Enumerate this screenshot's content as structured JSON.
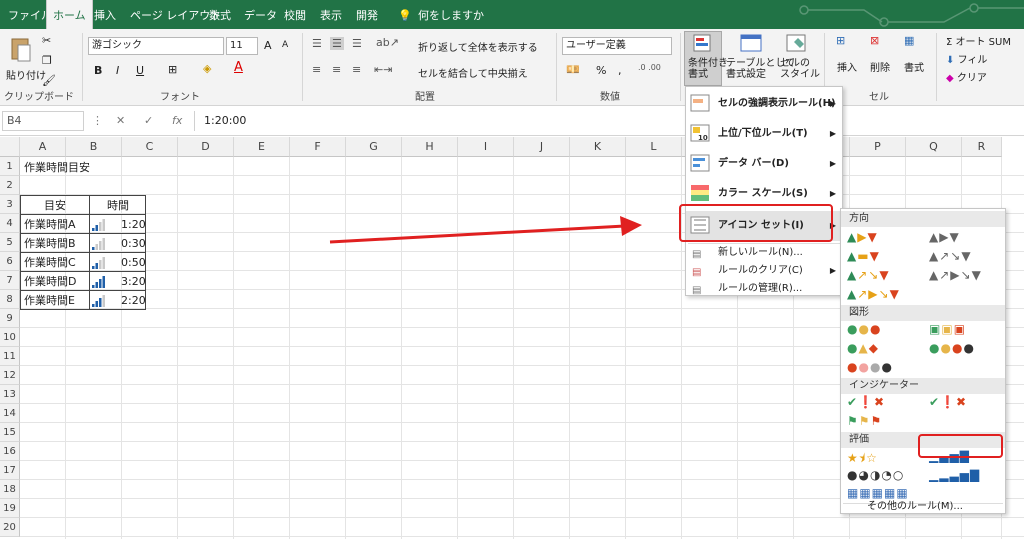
{
  "ribbon_tabs": [
    "ファイル",
    "ホーム",
    "挿入",
    "ページ レイアウト",
    "数式",
    "データ",
    "校閲",
    "表示",
    "開発",
    "何をしますか"
  ],
  "ribbon": {
    "clipboard": {
      "paste": "貼り付け",
      "label": "クリップボード"
    },
    "font": {
      "name": "游ゴシック",
      "size": "11",
      "label": "フォント",
      "grow": "A",
      "shrink": "A",
      "bold": "B",
      "italic": "I",
      "underline": "U"
    },
    "alignment": {
      "wrap": "折り返して全体を表示する",
      "merge": "セルを結合して中央揃え",
      "label": "配置"
    },
    "number": {
      "format": "ユーザー定義",
      "label": "数値",
      "percent": "%",
      "comma": ","
    },
    "styles": {
      "cond": "条件付き\n書式",
      "table": "テーブルとして\n書式設定",
      "cell": "セルの\nスタイル"
    },
    "cells": {
      "insert": "挿入",
      "delete": "削除",
      "format": "書式",
      "label": "セル"
    },
    "editing": {
      "autosum": "オート SUM",
      "fill": "フィル",
      "clear": "クリア"
    }
  },
  "formula_bar": {
    "namebox": "B4",
    "value": "1:20:00"
  },
  "columns": [
    "A",
    "B",
    "C",
    "D",
    "E",
    "F",
    "G",
    "H",
    "I",
    "J",
    "K",
    "L",
    "M",
    "N",
    "O",
    "P",
    "Q",
    "R"
  ],
  "rows": [
    "1",
    "2",
    "3",
    "4",
    "5",
    "6",
    "7",
    "8",
    "9",
    "10",
    "11",
    "12",
    "13",
    "14",
    "15",
    "16",
    "17",
    "18",
    "19",
    "20"
  ],
  "sheet": {
    "title": "作業時間目安",
    "header": [
      "目安",
      "時間"
    ],
    "data": [
      {
        "name": "作業時間A",
        "time": "1:20",
        "level": 2
      },
      {
        "name": "作業時間B",
        "time": "0:30",
        "level": 1
      },
      {
        "name": "作業時間C",
        "time": "0:50",
        "level": 2
      },
      {
        "name": "作業時間D",
        "time": "3:20",
        "level": 4
      },
      {
        "name": "作業時間E",
        "time": "2:20",
        "level": 3
      }
    ]
  },
  "cond_menu": {
    "items": [
      "セルの強調表示ルール(H)",
      "上位/下位ルール(T)",
      "データ バー(D)",
      "カラー スケール(S)",
      "アイコン セット(I)"
    ],
    "small": [
      "新しいルール(N)...",
      "ルールのクリア(C)",
      "ルールの管理(R)..."
    ]
  },
  "icon_menu": {
    "sections": [
      "方向",
      "図形",
      "インジケーター",
      "評価"
    ],
    "more": "その他のルール(M)..."
  },
  "colors": {
    "accent": "#217346",
    "highlight": "#e02020",
    "bar": "#1f5fa8"
  }
}
